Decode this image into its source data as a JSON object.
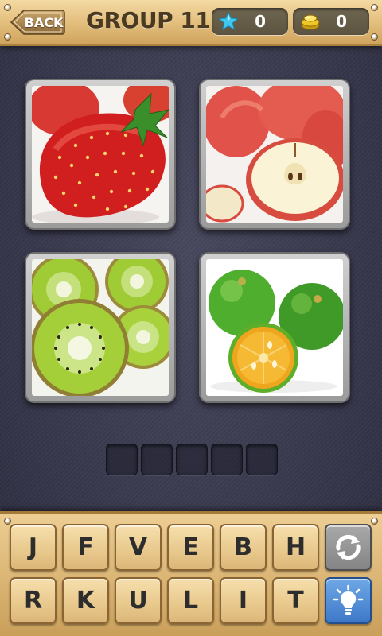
{
  "header": {
    "back_label": "BACK",
    "title": "GROUP 11",
    "stars": "0",
    "coins": "0"
  },
  "images": [
    {
      "icon": "strawberry-photo"
    },
    {
      "icon": "apple-photo"
    },
    {
      "icon": "kiwi-photo"
    },
    {
      "icon": "lime-photo"
    }
  ],
  "answer": {
    "slots": [
      "",
      "",
      "",
      "",
      ""
    ]
  },
  "keyboard": {
    "row1": [
      "J",
      "F",
      "V",
      "E",
      "B",
      "H"
    ],
    "row2": [
      "R",
      "K",
      "U",
      "L",
      "I",
      "T"
    ],
    "shuffle_icon": "shuffle-icon",
    "hint_icon": "lightbulb-icon"
  },
  "colors": {
    "wood": "#e2bd7b",
    "background": "#3a3a4e",
    "hint_button": "#3d78c8",
    "shuffle_button": "#848484"
  }
}
